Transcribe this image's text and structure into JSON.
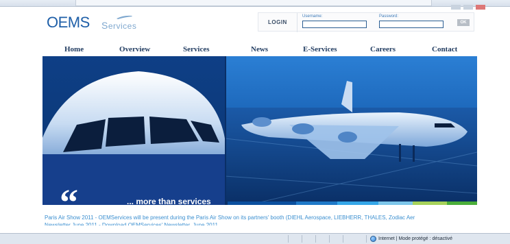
{
  "logo": {
    "brand": "OEMS",
    "suffix": "ervices"
  },
  "login": {
    "label": "LOGIN",
    "username_label": "Username:",
    "username_value": "",
    "password_label": "Password:",
    "password_value": "",
    "ok_label": "OK"
  },
  "nav": {
    "items": [
      {
        "label": "Home"
      },
      {
        "label": "Overview"
      },
      {
        "label": "Services"
      },
      {
        "label": "News"
      },
      {
        "label": "E-Services"
      },
      {
        "label": "Careers"
      },
      {
        "label": "Contact"
      }
    ]
  },
  "hero": {
    "quote_mark": "“",
    "tagline": "... more than services",
    "strip_colors": [
      "#0b4f9e",
      "#1f79c8",
      "#35a6e8",
      "#7dc6ea",
      "#a6d25a",
      "#4aae3a"
    ]
  },
  "news": {
    "line1": "Paris Air Show 2011 - OEMServices will be present during the Paris Air Show on its partners' booth (DIEHL Aerospace, LIEBHERR, THALES, Zodiac Aer",
    "line2": "Newsletter June 2011 - Download OEMServices' Newsletter, June 2011"
  },
  "status": {
    "text": "Internet | Mode protégé : désactivé",
    "icon": "globe-icon"
  }
}
